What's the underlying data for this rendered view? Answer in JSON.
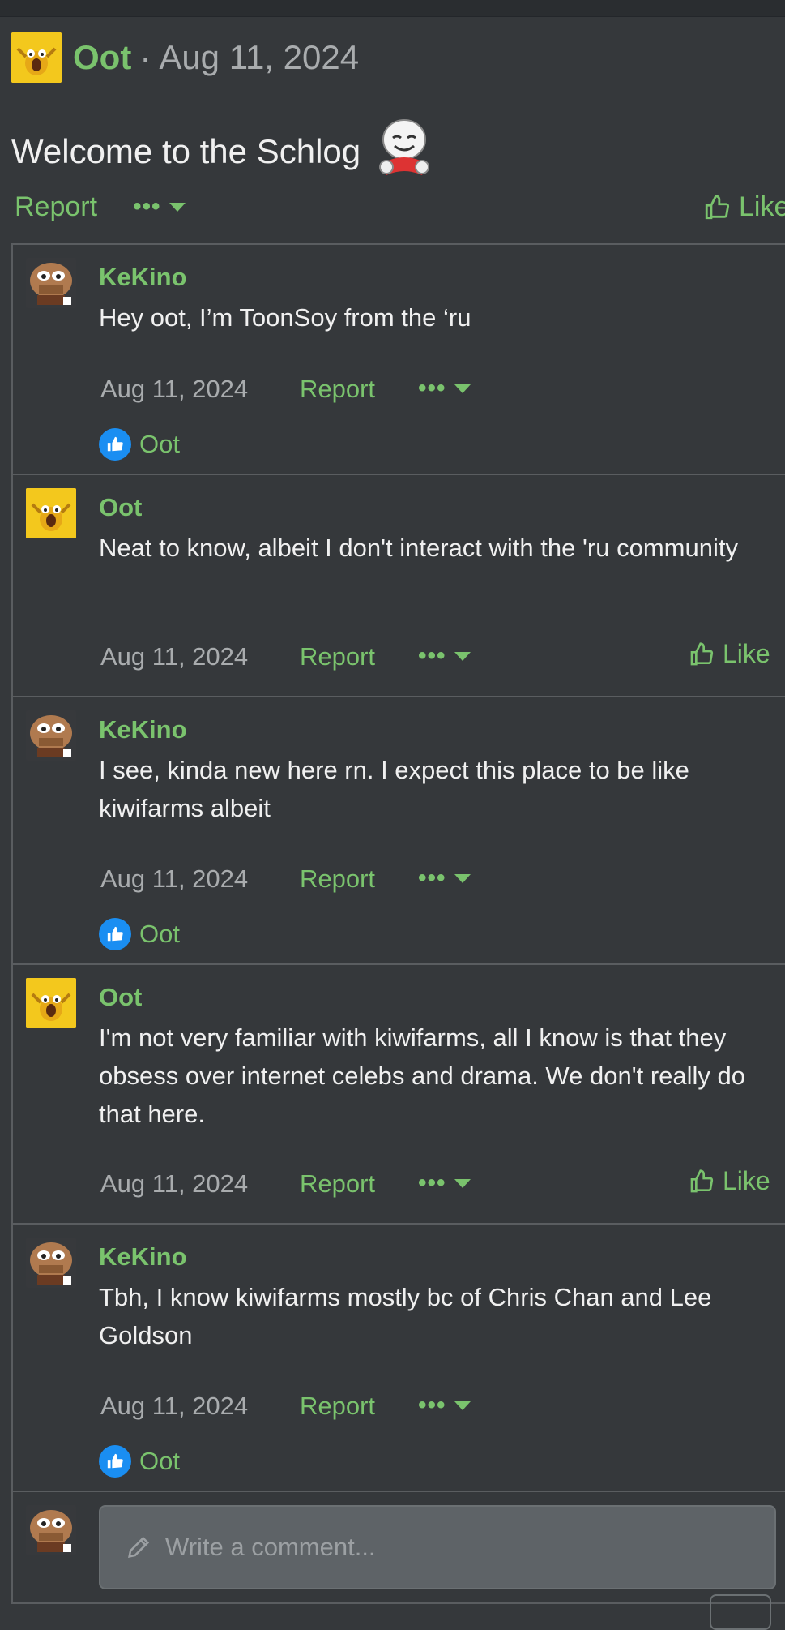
{
  "post": {
    "author": "Oot",
    "separator": "·",
    "date": "Aug 11, 2024",
    "body": "Welcome to the Schlog",
    "report_label": "Report",
    "more_label": "•••",
    "like_label": "Like"
  },
  "comments": [
    {
      "author": "KeKino",
      "avatar": "kekino-avatar",
      "text": "Hey oot, I’m ToonSoy from the ‘ru",
      "date": "Aug 11, 2024",
      "report_label": "Report",
      "more_label": "•••",
      "reaction_user": "Oot"
    },
    {
      "author": "Oot",
      "avatar": "oot-avatar",
      "text": "Neat to know, albeit I don't interact with the 'ru community",
      "date": "Aug 11, 2024",
      "report_label": "Report",
      "more_label": "•••",
      "like_label": "Like"
    },
    {
      "author": "KeKino",
      "avatar": "kekino-avatar",
      "text": "I see, kinda new here rn. I expect this place to be like kiwifarms albeit",
      "date": "Aug 11, 2024",
      "report_label": "Report",
      "more_label": "•••",
      "reaction_user": "Oot"
    },
    {
      "author": "Oot",
      "avatar": "oot-avatar",
      "text": "I'm not very familiar with kiwifarms, all I know is that they obsess over internet celebs and drama. We don't really do that here.",
      "date": "Aug 11, 2024",
      "report_label": "Report",
      "more_label": "•••",
      "like_label": "Like"
    },
    {
      "author": "KeKino",
      "avatar": "kekino-avatar",
      "text": "Tbh, I know kiwifarms mostly bc of Chris Chan and Lee Goldson",
      "date": "Aug 11, 2024",
      "report_label": "Report",
      "more_label": "•••",
      "reaction_user": "Oot"
    }
  ],
  "compose": {
    "placeholder": "Write a comment..."
  },
  "colors": {
    "background": "#35383b",
    "accent": "#7ac36d",
    "muted": "#a9acae",
    "reaction": "#1a8ef2"
  }
}
